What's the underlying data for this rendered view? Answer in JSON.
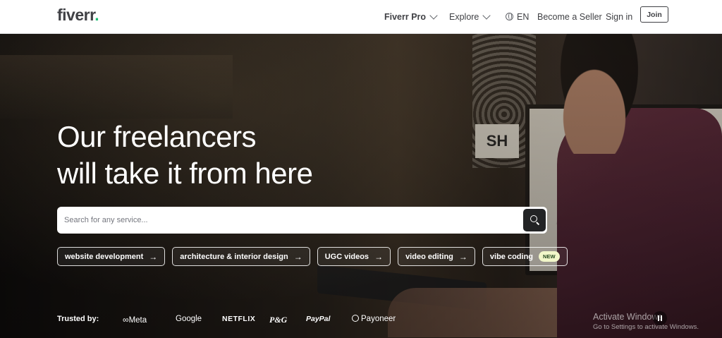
{
  "header": {
    "logo_text": "fiverr",
    "logo_dot": ".",
    "nav": {
      "fiverr_pro": "Fiverr Pro",
      "explore": "Explore",
      "language": "EN",
      "become_seller": "Become a Seller",
      "sign_in": "Sign in",
      "join": "Join"
    }
  },
  "hero": {
    "headline_line1": "Our freelancers",
    "headline_line2": "will take it from here",
    "search": {
      "placeholder": "Search for any service...",
      "value": ""
    },
    "chips": [
      {
        "label": "website development"
      },
      {
        "label": "architecture & interior design"
      },
      {
        "label": "UGC videos"
      },
      {
        "label": "video editing"
      },
      {
        "label": "vibe coding",
        "badge": "NEW"
      }
    ],
    "arrow": "→",
    "background_poster_text": "SH",
    "trusted_by": {
      "label": "Trusted by:",
      "brands": [
        "Meta",
        "Google",
        "NETFLIX",
        "P&G",
        "PayPal",
        "Payoneer"
      ]
    }
  },
  "watermark": {
    "title": "Activate Windows",
    "subtitle": "Go to Settings to activate Windows."
  },
  "colors": {
    "brand_green": "#1dbf73",
    "text_dark": "#404145",
    "search_button": "#222325",
    "new_badge_bg": "#f1f6c9"
  },
  "icons": {
    "search_button": "magnifier-icon",
    "language": "globe-icon",
    "dropdown": "chevron-down-icon",
    "chip_arrow": "arrow-right-icon",
    "video_control": "pause-icon"
  }
}
